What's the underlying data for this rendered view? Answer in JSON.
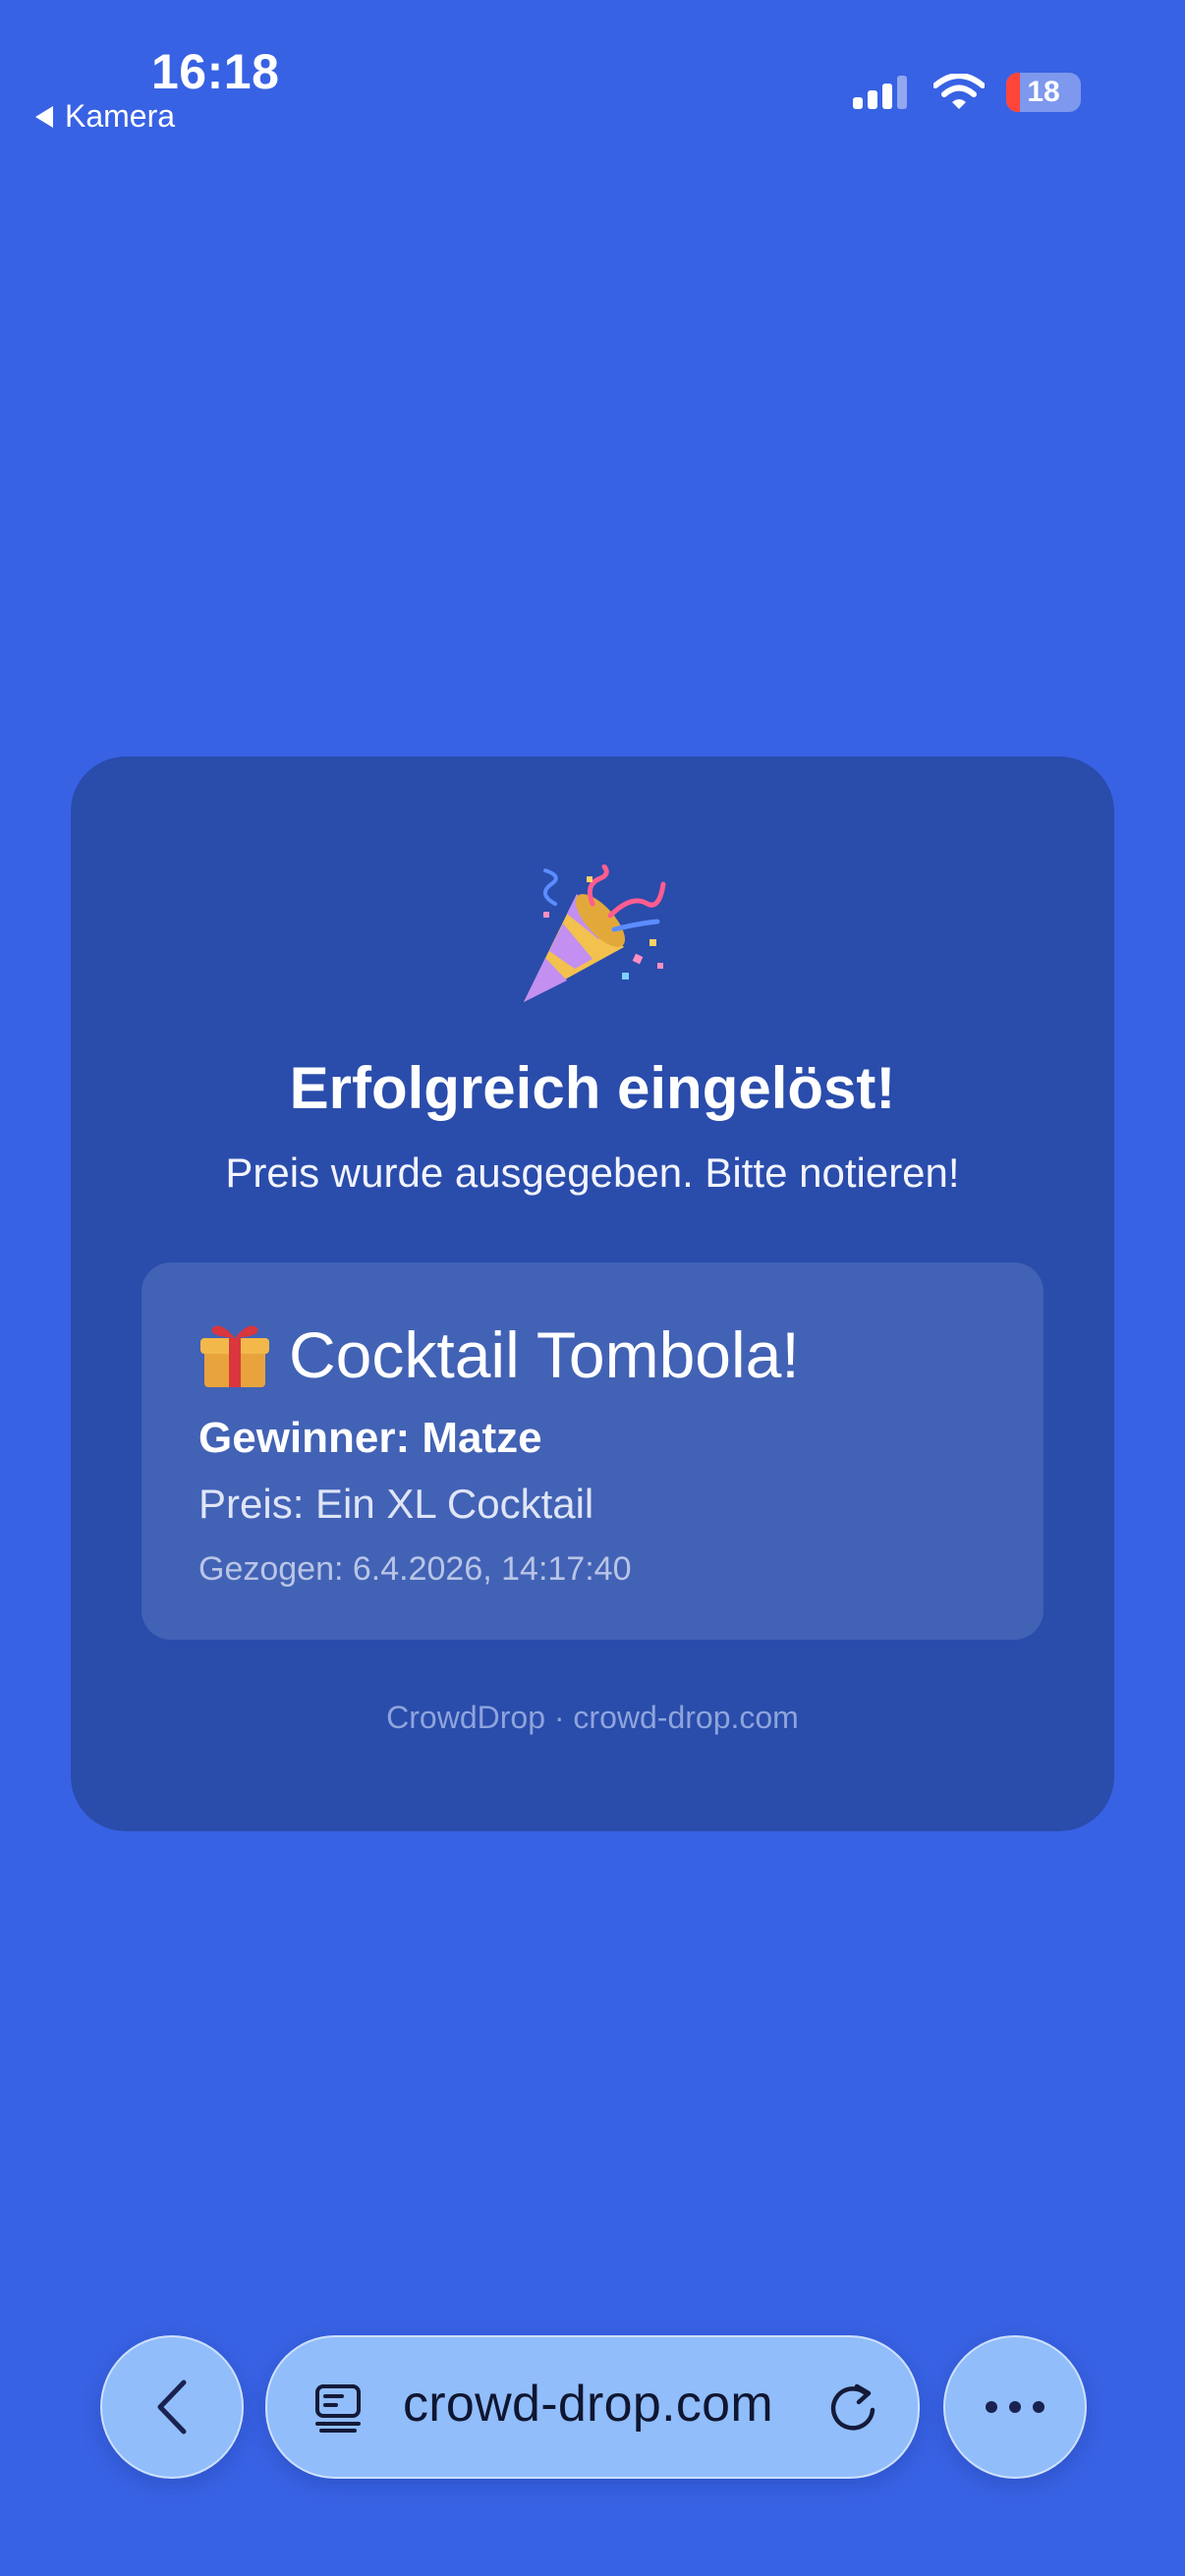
{
  "status_bar": {
    "time": "16:18",
    "back_app": "Kamera",
    "battery_level": "18"
  },
  "card": {
    "title": "Erfolgreich eingelöst!",
    "subtitle": "Preis wurde ausgegeben. Bitte notieren!",
    "prize": {
      "event_title": "Cocktail Tombola!",
      "winner": "Gewinner: Matze",
      "prize": "Preis: Ein XL Cocktail",
      "drawn": "Gezogen: 6.4.2026, 14:17:40"
    },
    "footer": "CrowdDrop · crowd-drop.com"
  },
  "browser": {
    "url": "crowd-drop.com"
  },
  "colors": {
    "background": "#3862e4",
    "card": "#2a4cab",
    "prize_box": "#4262b5",
    "toolbar_button": "#91bdfb"
  },
  "icons": {
    "celebration": "party-popper-icon",
    "prize": "gift-icon",
    "back": "chevron-left-icon",
    "tabs": "tabs-icon",
    "reload": "reload-icon",
    "more": "ellipsis-icon"
  }
}
